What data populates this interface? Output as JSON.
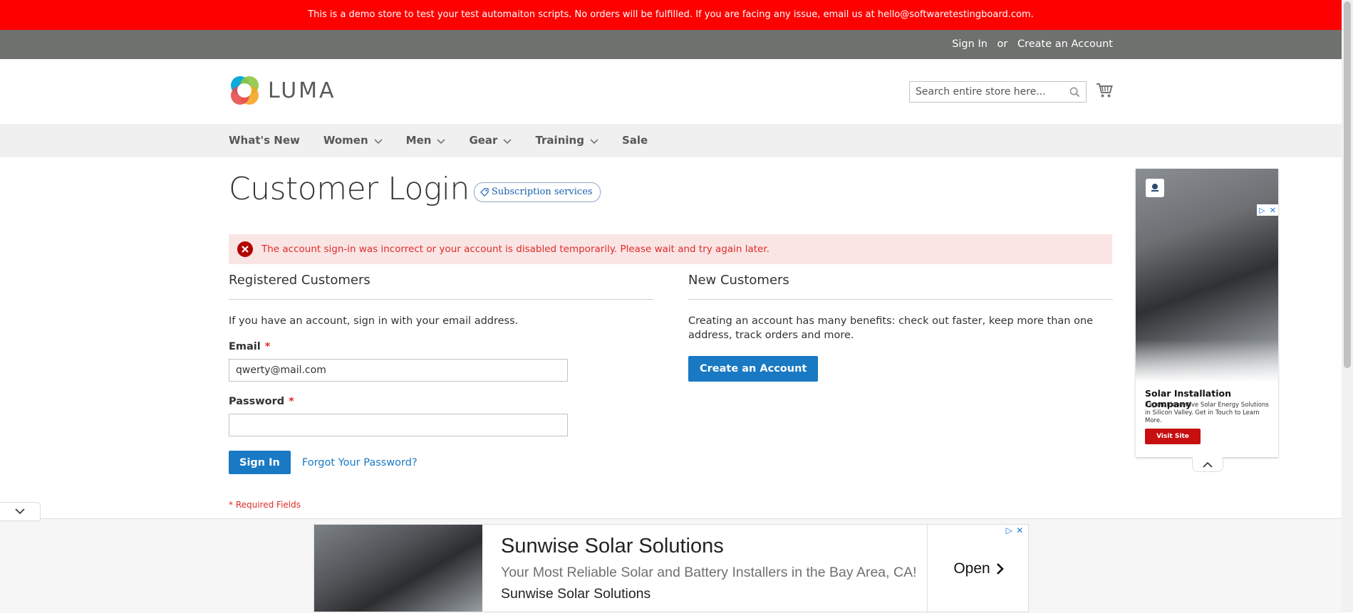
{
  "demo_notice": "This is a demo store to test your test automaiton scripts. No orders will be fulfilled. If you are facing any issue, email us at hello@softwaretestingboard.com.",
  "top_links": {
    "sign_in": "Sign In",
    "or": "or",
    "create_account": "Create an Account"
  },
  "header": {
    "logo_text": "LUMA",
    "search_placeholder": "Search entire store here...",
    "search_icon": "search-icon",
    "cart_icon": "cart-icon"
  },
  "nav": {
    "items": [
      {
        "label": "What's New",
        "has_dropdown": false
      },
      {
        "label": "Women",
        "has_dropdown": true
      },
      {
        "label": "Men",
        "has_dropdown": true
      },
      {
        "label": "Gear",
        "has_dropdown": true
      },
      {
        "label": "Training",
        "has_dropdown": true
      },
      {
        "label": "Sale",
        "has_dropdown": false
      }
    ]
  },
  "page": {
    "title": "Customer Login",
    "subscription_badge": "Subscription services"
  },
  "alert": {
    "message": "The account sign-in was incorrect or your account is disabled temporarily. Please wait and try again later.",
    "color": "#e02b27"
  },
  "registered": {
    "title": "Registered Customers",
    "intro": "If you have an account, sign in with your email address.",
    "email_label": "Email",
    "email_value": "qwerty@mail.com",
    "password_label": "Password",
    "password_value": "",
    "required_mark": "*",
    "sign_in_button": "Sign In",
    "forgot_link": "Forgot Your Password?",
    "required_note": "* Required Fields"
  },
  "new_customers": {
    "title": "New Customers",
    "text": "Creating an account has many benefits: check out faster, keep more than one address, track orders and more.",
    "create_button": "Create an Account"
  },
  "side_ad": {
    "title": "Solar Installation Company",
    "description": "Expert Innovative Solar Energy Solutions in Silicon Valley. Get in Touch to Learn More.",
    "button": "Visit Site"
  },
  "bottom_ad": {
    "headline": "Sunwise Solar Solutions",
    "subline": "Your Most Reliable Solar and Battery Installers in the Bay Area, CA!",
    "advertiser": "Sunwise Solar Solutions",
    "open_label": "Open"
  },
  "colors": {
    "demo_bar": "#ff0000",
    "top_bar": "#6e716e",
    "primary": "#1979c3",
    "alert_bg": "#fae5e5"
  }
}
